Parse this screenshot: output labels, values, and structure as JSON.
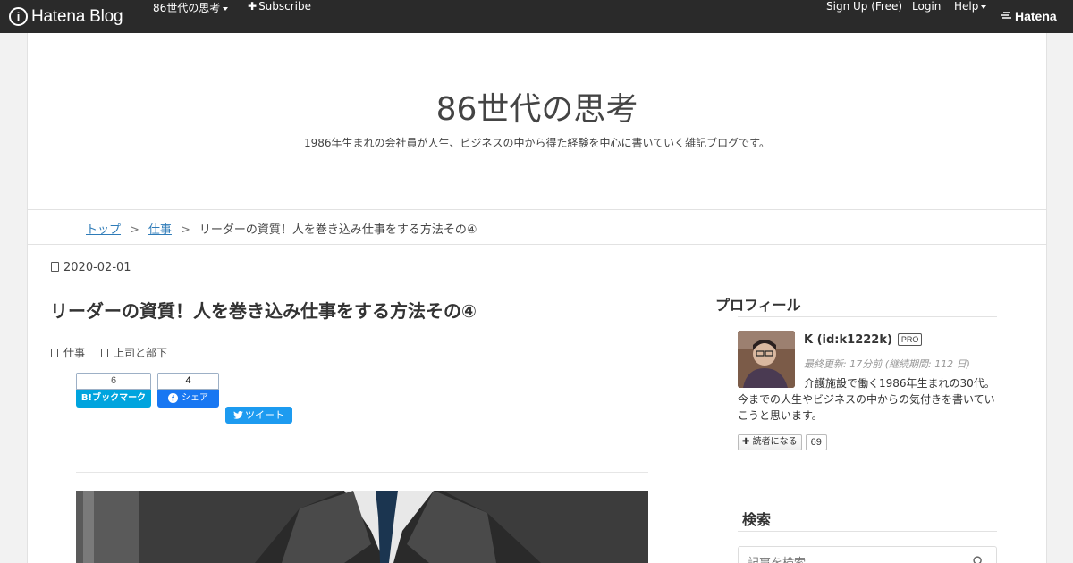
{
  "global_header": {
    "logo_text": "Hatena Blog",
    "blog_menu_label": "86世代の思考",
    "subscribe_label": "Subscribe",
    "signup_label": "Sign Up (Free)",
    "login_label": "Login",
    "help_label": "Help",
    "hatena_label": "Hatena"
  },
  "blog": {
    "title": "86世代の思考",
    "description": "1986年生まれの会社員が人生、ビジネスの中から得た経験を中心に書いていく雑記ブログです。"
  },
  "breadcrumb": {
    "top": "トップ",
    "separator": ">",
    "category": "仕事",
    "current": "リーダーの資質！人を巻き込み仕事をする方法その④"
  },
  "entry": {
    "date": "2020-02-01",
    "title": "リーダーの資質！人を巻き込み仕事をする方法その④",
    "categories": [
      "仕事",
      "上司と部下"
    ]
  },
  "social": {
    "hatena_count": "6",
    "hatena_label": "B!ブックマーク",
    "facebook_count": "4",
    "facebook_label": "シェア",
    "twitter_label": "ツイート"
  },
  "sidebar": {
    "profile_title": "プロフィール",
    "profile_name": "K (id:k1222k)",
    "pro_label": "PRO",
    "updated": "最終更新: 17分前 (継続期間: 112 日)",
    "description": "介護施設で働く1986年生まれの30代。今までの人生やビジネスの中からの気付きを書いていこうと思います。",
    "reader_button": "読者になる",
    "reader_count": "69",
    "search_title": "検索",
    "search_placeholder": "記事を検索"
  }
}
